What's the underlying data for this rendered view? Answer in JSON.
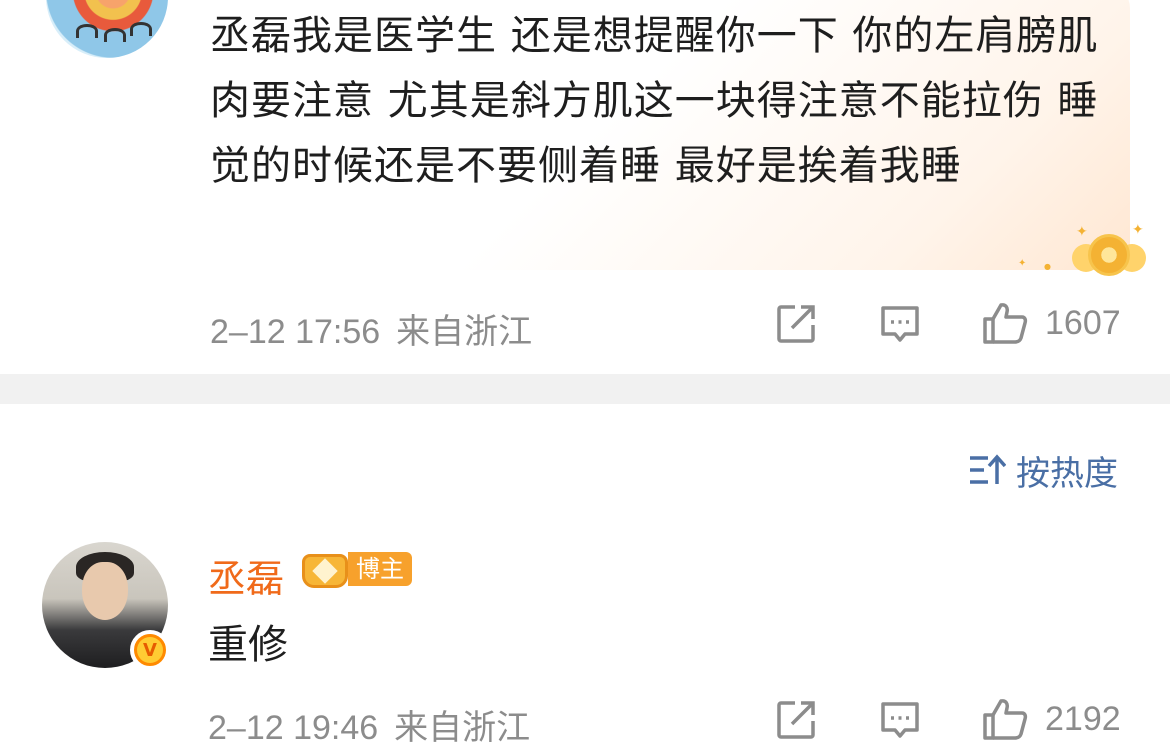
{
  "top_comment": {
    "text": "丞磊我是医学生  还是想提醒你一下 你的左肩膀肌肉要注意 尤其是斜方肌这一块得注意不能拉伤 睡觉的时候还是不要侧着睡 最好是挨着我睡",
    "date": "2–12 17:56",
    "location": "来自浙江",
    "likes": "1607",
    "badge_icon": "star-fan-badge-icon"
  },
  "sort": {
    "label": "按热度",
    "icon": "sort-icon"
  },
  "reply_comment": {
    "username": "丞磊",
    "role_tag": "博主",
    "text": "重修",
    "date": "2–12 19:46",
    "location": "来自浙江",
    "likes": "2192",
    "verified_icon": "verified-v-icon"
  },
  "colors": {
    "username": "#f06a1a",
    "meta_gray": "#8c8c8c",
    "sort_blue": "#4a6fa5",
    "divider": "#f1f1f1",
    "host_tag": "#f7a12c"
  }
}
